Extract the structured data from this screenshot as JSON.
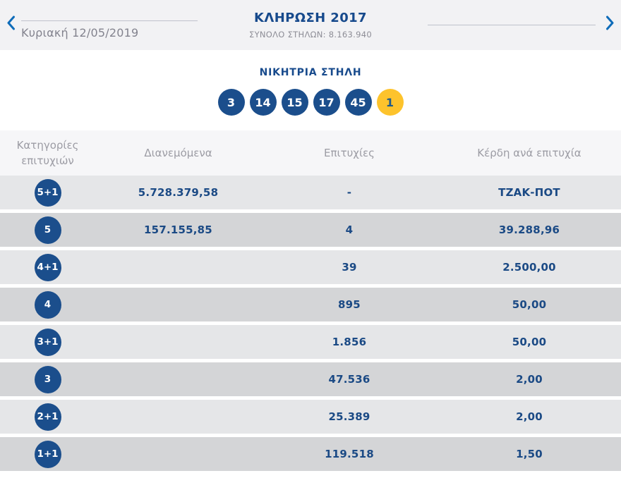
{
  "header": {
    "date": "Κυριακή 12/05/2019",
    "title": "ΚΛΗΡΩΣΗ 2017",
    "subtitle": "ΣΥΝΟΛΟ ΣΤΗΛΩΝ: 8.163.940",
    "prev_icon": "chevron-left",
    "next_icon": "chevron-right"
  },
  "winning_column": {
    "title": "ΝΙΚΗΤΡΙΑ ΣΤΗΛΗ",
    "numbers": [
      "3",
      "14",
      "15",
      "17",
      "45"
    ],
    "bonus_number": "1"
  },
  "results_table": {
    "columns": {
      "category": "Κατηγορίες επιτυχιών",
      "distributed": "Διανεμόμενα",
      "winners": "Επιτυχίες",
      "prize": "Κέρδη ανά επιτυχία"
    },
    "rows": [
      {
        "category": "5+1",
        "distributed": "5.728.379,58",
        "winners": "-",
        "prize": "ΤΖΑΚ-ΠΟΤ"
      },
      {
        "category": "5",
        "distributed": "157.155,85",
        "winners": "4",
        "prize": "39.288,96"
      },
      {
        "category": "4+1",
        "distributed": "",
        "winners": "39",
        "prize": "2.500,00"
      },
      {
        "category": "4",
        "distributed": "",
        "winners": "895",
        "prize": "50,00"
      },
      {
        "category": "3+1",
        "distributed": "",
        "winners": "1.856",
        "prize": "50,00"
      },
      {
        "category": "3",
        "distributed": "",
        "winners": "47.536",
        "prize": "2,00"
      },
      {
        "category": "2+1",
        "distributed": "",
        "winners": "25.389",
        "prize": "2,00"
      },
      {
        "category": "1+1",
        "distributed": "",
        "winners": "119.518",
        "prize": "1,50"
      }
    ]
  },
  "colors": {
    "brand_blue": "#1b4e8c",
    "bonus_yellow": "#fdc32c",
    "chevron_blue": "#0e6cb9",
    "row_light": "#e5e6e8",
    "row_dark": "#d4d5d7",
    "muted_gray": "#9c9ca4"
  }
}
